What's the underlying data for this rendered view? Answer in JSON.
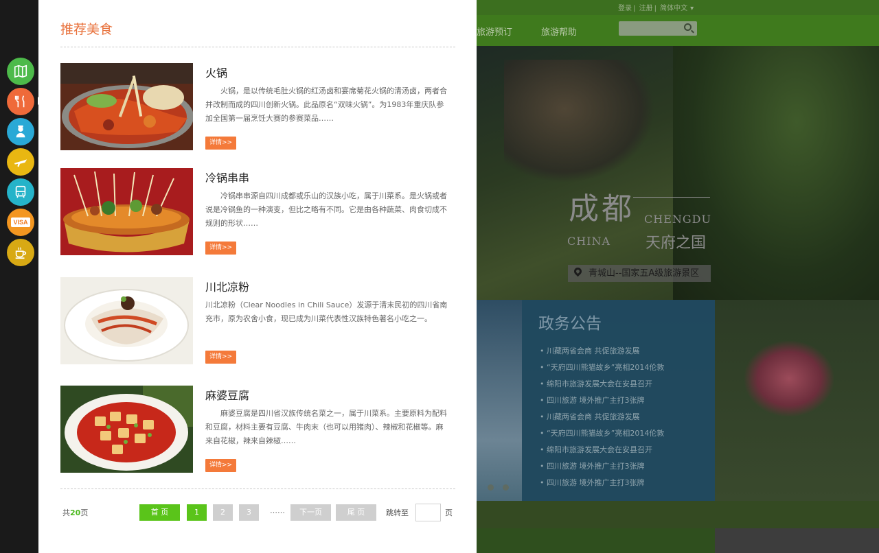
{
  "background_site": {
    "top_links": [
      "登录",
      "注册",
      "简体中文"
    ],
    "nav": [
      "旅游预订",
      "旅游帮助"
    ],
    "logo_cn": "成都",
    "logo_en": "CHENGDU",
    "logo_china": "CHINA",
    "logo_motto": "天府之国",
    "location_caption": "青城山--国家五A级旅游景区",
    "notice_title": "政务公告",
    "notices": [
      "• 川藏两省会商 共促旅游发展",
      "• “天府四川熊猫故乡”亮相2014伦敦",
      "• 绵阳市旅游发展大会在安县召开",
      "• 四川旅游 境外推广主打3张牌",
      "• 川藏两省会商 共促旅游发展",
      "• “天府四川熊猫故乡”亮相2014伦敦",
      "• 绵阳市旅游发展大会在安县召开",
      "• 四川旅游 境外推广主打3张牌",
      "• 四川旅游 境外推广主打3张牌"
    ]
  },
  "rail": {
    "icons": [
      {
        "name": "map-guide-icon",
        "color": "#4dba4a"
      },
      {
        "name": "food-fork-knife-icon",
        "color": "#ef6a3a"
      },
      {
        "name": "tour-guide-person-icon",
        "color": "#2aa9d6"
      },
      {
        "name": "airplane-icon",
        "color": "#e9b712"
      },
      {
        "name": "bus-icon",
        "color": "#25b3c9"
      },
      {
        "name": "visa-card-icon",
        "color": "#f39620"
      },
      {
        "name": "coffee-cup-icon",
        "color": "#d8a914"
      }
    ],
    "visa_text": "VISA"
  },
  "panel": {
    "title": "推荐美食",
    "foods": [
      {
        "name": "火锅",
        "desc": "　　火锅，是以传统毛肚火锅的红汤卤和宴席菊花火锅的清汤卤，两者合并改制而成的四川创新火锅。此品原名“双味火锅”。为1983年重庆队参加全国第一届烹饪大赛的参赛菜品……",
        "more": "详情>>"
      },
      {
        "name": "冷锅串串",
        "desc": "　　冷锅串串源自四川成都或乐山的汉族小吃，属于川菜系。是火锅或者说是冷锅鱼的一种演变，但比之略有不同。它是由各种蔬菜、肉食切成不规则的形状……",
        "more": "详情>>"
      },
      {
        "name": "川北凉粉",
        "desc": "川北凉粉（Clear Noodles in Chili Sauce）发源于清末民初的四川省南充市，原为农舍小食，现已成为川菜代表性汉族特色著名小吃之一。",
        "more": "详情>>"
      },
      {
        "name": "麻婆豆腐",
        "desc": "　　麻婆豆腐是四川省汉族传统名菜之一，属于川菜系。主要原料为配料和豆腐，材料主要有豆腐、牛肉末（也可以用猪肉）、辣椒和花椒等。麻来自花椒，辣来自辣椒……",
        "more": "详情>>"
      }
    ],
    "pager": {
      "total_prefix": "共",
      "total_count": "20",
      "total_suffix": "页",
      "first": "首 页",
      "pages": [
        "1",
        "2",
        "3"
      ],
      "current": "1",
      "ellipsis": "……",
      "next": "下一页",
      "last": "尾 页",
      "jump_label": "跳转至",
      "jump_value": "",
      "page_unit": "页"
    }
  }
}
